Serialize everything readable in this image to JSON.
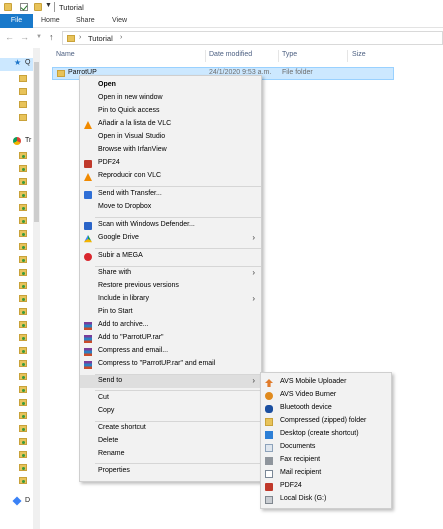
{
  "window": {
    "title": "Tutorial"
  },
  "ribbon": {
    "tabs": [
      "File",
      "Home",
      "Share",
      "View"
    ],
    "active": "File",
    "accent": "#1979ca"
  },
  "address": {
    "path": [
      "Tutorial"
    ]
  },
  "nav_pane": {
    "quick_access_label": "Q",
    "chrome_label": "Tr",
    "dropbox_label": "D"
  },
  "columns": {
    "name": "Name",
    "date": "Date modified",
    "type": "Type",
    "size": "Size"
  },
  "selected_item": {
    "name": "ParrotUP",
    "date": "24/1/2020 9:53 a.m.",
    "type": "File folder"
  },
  "context_menu": {
    "items": [
      {
        "label": "Open",
        "bold": true,
        "icon": ""
      },
      {
        "label": "Open in new window",
        "icon": ""
      },
      {
        "label": "Pin to Quick access",
        "icon": ""
      },
      {
        "label": "Añadir a la lista de VLC",
        "icon": "vlc-icon"
      },
      {
        "label": "Open in Visual Studio",
        "icon": ""
      },
      {
        "label": "Browse with IrfanView",
        "icon": ""
      },
      {
        "label": "PDF24",
        "icon": "pdf24-icon"
      },
      {
        "label": "Reproducir con VLC",
        "icon": "vlc-icon"
      },
      {
        "label": "Send with Transfer...",
        "icon": "transfer-icon"
      },
      {
        "label": "Move to Dropbox",
        "icon": ""
      },
      {
        "label": "Scan with Windows Defender...",
        "icon": "defender-icon"
      },
      {
        "label": "Google Drive",
        "icon": "google-drive-icon",
        "submenu": true
      },
      {
        "label": "Subir a MEGA",
        "icon": "mega-icon"
      },
      {
        "label": "Share with",
        "icon": "",
        "submenu": true
      },
      {
        "label": "Restore previous versions",
        "icon": ""
      },
      {
        "label": "Include in library",
        "icon": "",
        "submenu": true
      },
      {
        "label": "Pin to Start",
        "icon": ""
      },
      {
        "label": "Add to archive...",
        "icon": "winrar-icon"
      },
      {
        "label": "Add to \"ParrotUP.rar\"",
        "icon": "winrar-icon"
      },
      {
        "label": "Compress and email...",
        "icon": "winrar-icon"
      },
      {
        "label": "Compress to \"ParrotUP.rar\" and email",
        "icon": "winrar-icon"
      },
      {
        "label": "Send to",
        "icon": "",
        "submenu": true,
        "highlighted": true
      },
      {
        "label": "Cut",
        "icon": ""
      },
      {
        "label": "Copy",
        "icon": ""
      },
      {
        "label": "Create shortcut",
        "icon": ""
      },
      {
        "label": "Delete",
        "icon": ""
      },
      {
        "label": "Rename",
        "icon": ""
      },
      {
        "label": "Properties",
        "icon": ""
      }
    ]
  },
  "send_to_menu": {
    "items": [
      {
        "label": "AVS Mobile Uploader",
        "icon": "upload-icon"
      },
      {
        "label": "AVS Video Burner",
        "icon": "avs-icon"
      },
      {
        "label": "Bluetooth device",
        "icon": "bluetooth-icon"
      },
      {
        "label": "Compressed (zipped) folder",
        "icon": "zip-folder-icon"
      },
      {
        "label": "Desktop (create shortcut)",
        "icon": "desktop-icon"
      },
      {
        "label": "Documents",
        "icon": "documents-icon"
      },
      {
        "label": "Fax recipient",
        "icon": "fax-icon"
      },
      {
        "label": "Mail recipient",
        "icon": "mail-icon"
      },
      {
        "label": "PDF24",
        "icon": "pdf24-icon"
      },
      {
        "label": "Local Disk (G:)",
        "icon": "disk-icon"
      }
    ]
  }
}
